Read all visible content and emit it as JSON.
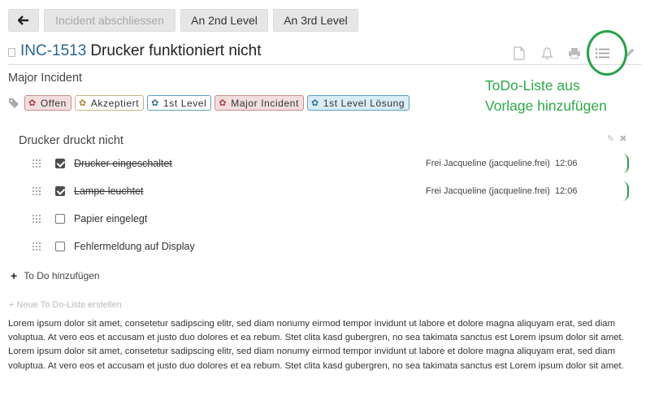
{
  "toolbar": {
    "back_icon": "arrow-left-icon",
    "close_incident": "Incident abschliessen",
    "second_level": "An 2nd Level",
    "third_level": "An 3rd Level"
  },
  "ticket": {
    "id": "INC-1513",
    "title": "Drucker funktioniert nicht",
    "category": "Major Incident"
  },
  "header_icons": [
    "document-icon",
    "bell-icon",
    "print-icon",
    "list-icon",
    "pencil-icon"
  ],
  "annotation": {
    "line1": "ToDo-Liste aus",
    "line2": "Vorlage hinzufügen",
    "color": "#22a347"
  },
  "tags": [
    {
      "label": "Offen",
      "style": "red"
    },
    {
      "label": "Akzeptiert",
      "style": "beige"
    },
    {
      "label": "1st Level",
      "style": "blue"
    },
    {
      "label": "Major Incident",
      "style": "red"
    },
    {
      "label": "1st Level Lösung",
      "style": "cyan"
    }
  ],
  "todo_list": {
    "title": "Drucker druckt nicht",
    "items": [
      {
        "text": "Drucker eingeschaltet",
        "done": true,
        "user": "Frei Jacqueline (jacqueline.frei)",
        "time": "12:06"
      },
      {
        "text": "Lampe leuchtet",
        "done": true,
        "user": "Frei Jacqueline (jacqueline.frei)",
        "time": "12:06"
      },
      {
        "text": "Papier eingelegt",
        "done": false
      },
      {
        "text": "Fehlermeldung auf Display",
        "done": false
      }
    ],
    "add_label": "To Do hinzufügen"
  },
  "new_list_label": "Neue To Do-Liste erstellen",
  "description": "Lorem ipsum dolor sit amet, consetetur sadipscing elitr, sed diam nonumy eirmod tempor invidunt ut labore et dolore magna aliquyam erat, sed diam voluptua. At vero eos et accusam et justo duo dolores et ea rebum. Stet clita kasd gubergren, no sea takimata sanctus est Lorem ipsum dolor sit amet. Lorem ipsum dolor sit amet, consetetur sadipscing elitr, sed diam nonumy eirmod tempor invidunt ut labore et dolore magna aliquyam erat, sed diam voluptua. At vero eos et accusam et justo duo dolores et ea rebum. Stet clita kasd gubergren, no sea takimata sanctus est Lorem ipsum dolor sit amet."
}
